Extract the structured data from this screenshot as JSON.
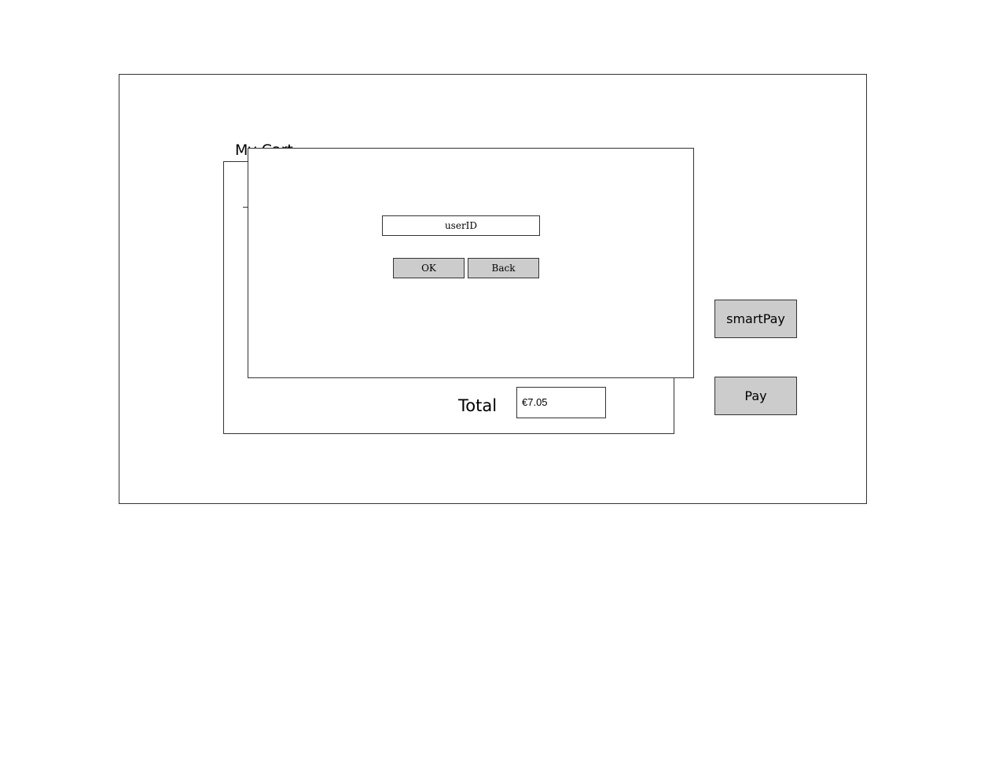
{
  "cart": {
    "title": "My Cart",
    "total_label": "Total",
    "total_value": "€7.05"
  },
  "actions": {
    "smartpay_label": "smartPay",
    "pay_label": "Pay"
  },
  "dialog": {
    "userid_placeholder": "userID",
    "ok_label": "OK",
    "back_label": "Back"
  }
}
